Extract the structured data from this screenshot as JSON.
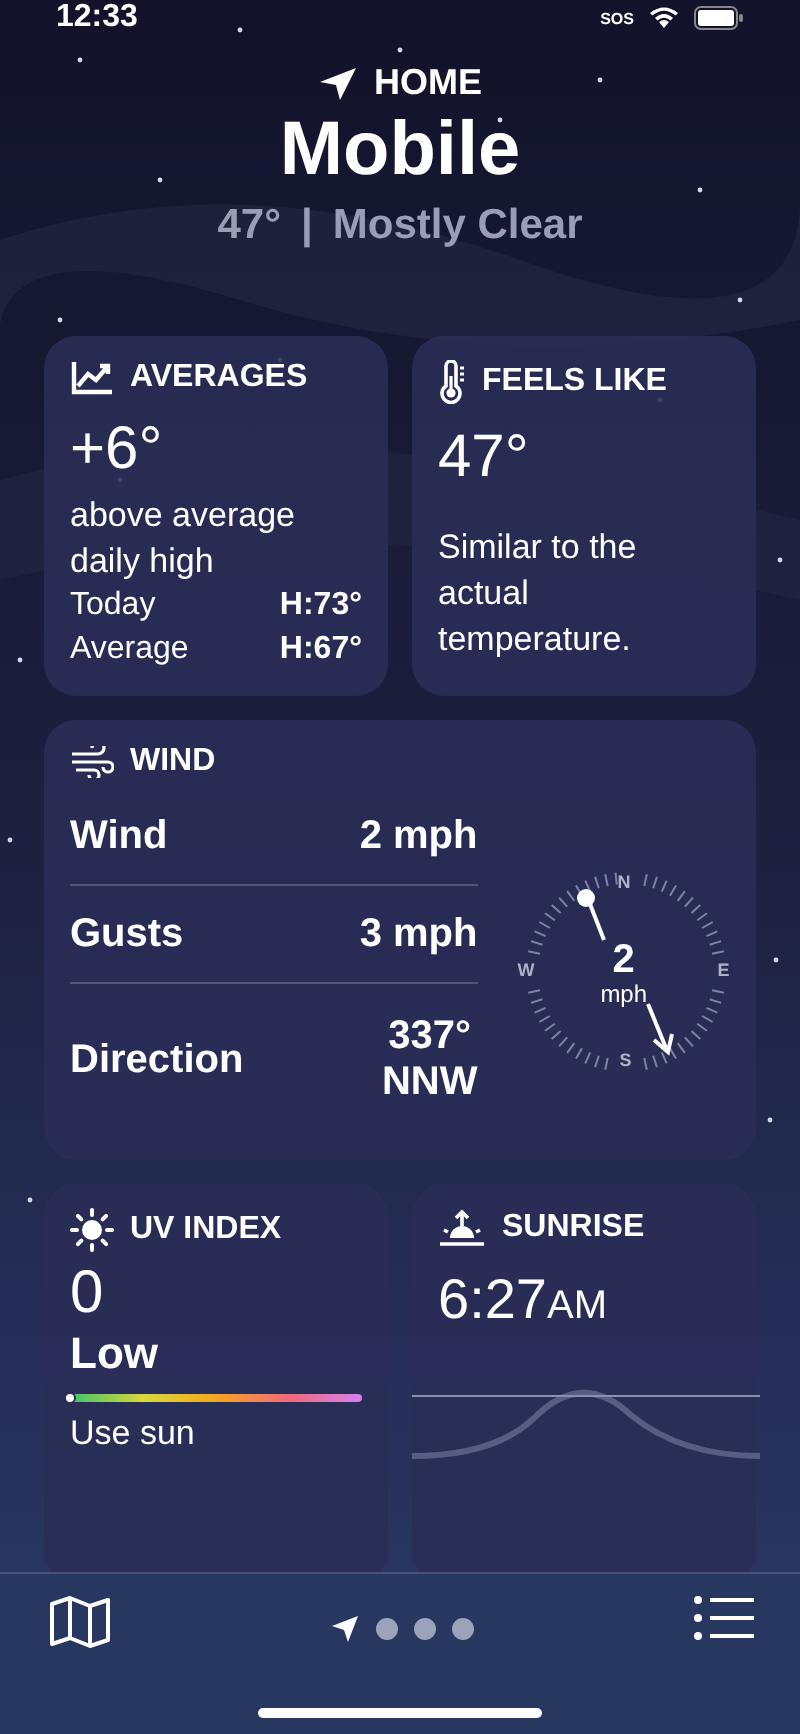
{
  "status_bar": {
    "time": "12:33",
    "sos": "SOS"
  },
  "header": {
    "label": "HOME",
    "city": "Mobile",
    "temperature": "47°",
    "separator": "|",
    "condition": "Mostly Clear"
  },
  "averages": {
    "title": "AVERAGES",
    "value": "+6°",
    "description": "above average daily high",
    "rows": [
      {
        "label": "Today",
        "value": "H:73°"
      },
      {
        "label": "Average",
        "value": "H:67°"
      }
    ]
  },
  "feels_like": {
    "title": "FEELS LIKE",
    "value": "47°",
    "description": "Similar to the actual temperature."
  },
  "wind": {
    "title": "WIND",
    "rows": [
      {
        "label": "Wind",
        "value": "2 mph"
      },
      {
        "label": "Gusts",
        "value": "3 mph"
      },
      {
        "label": "Direction",
        "value": "337°",
        "value2": "NNW"
      }
    ],
    "compass": {
      "speed": "2",
      "unit": "mph",
      "n": "N",
      "e": "E",
      "s": "S",
      "w": "W"
    }
  },
  "uv_index": {
    "title": "UV INDEX",
    "value": "0",
    "category": "Low",
    "level": 0,
    "description": "Use sun"
  },
  "sunrise": {
    "title": "SUNRISE",
    "time": "6:27",
    "suffix": "AM"
  },
  "tab_bar": {
    "pages": [
      {
        "kind": "location",
        "selected": true
      },
      {
        "kind": "dot",
        "selected": false
      },
      {
        "kind": "dot",
        "selected": false
      },
      {
        "kind": "dot",
        "selected": false
      }
    ]
  }
}
